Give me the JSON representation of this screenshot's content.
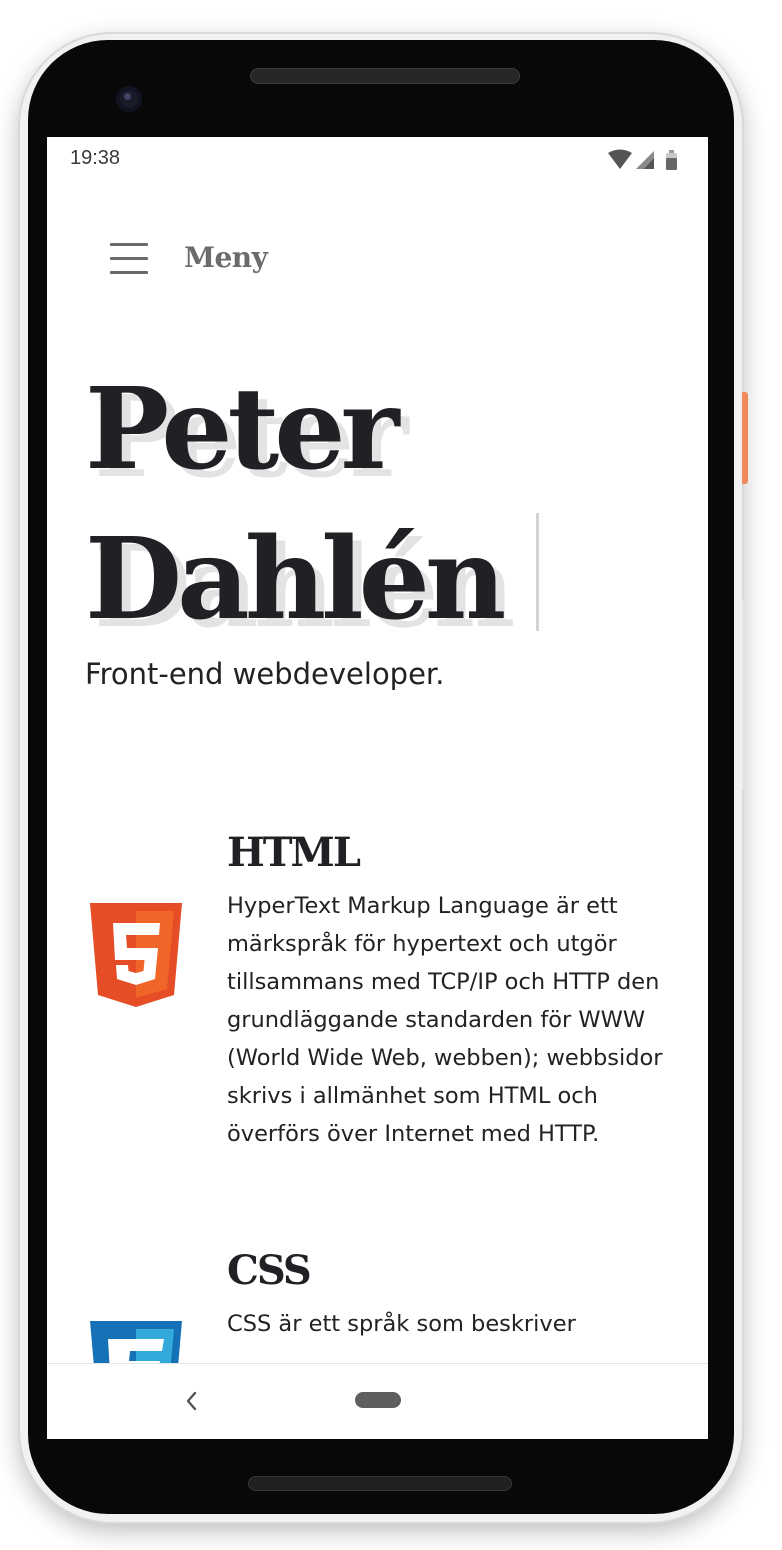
{
  "status_bar": {
    "time": "19:38",
    "icons": [
      "wifi-icon",
      "signal-icon",
      "battery-icon"
    ]
  },
  "menu": {
    "label": "Meny"
  },
  "hero": {
    "name_line1": "Peter",
    "name_line2": "Dahlén",
    "subtitle": "Front-end webdeveloper."
  },
  "skills": [
    {
      "title": "HTML",
      "icon": "html5-logo-icon",
      "description": "HyperText Markup Language är ett märkspråk för hypertext och utgör tillsammans med TCP/IP och HTTP den grundläggande standarden för WWW (World Wide Web, webben); webbsidor skrivs i allmänhet som HTML och överförs över Internet med HTTP."
    },
    {
      "title": "CSS",
      "icon": "css3-logo-icon",
      "description": "CSS är ett språk som beskriver"
    }
  ],
  "colors": {
    "html5_orange": "#e44d26",
    "html5_orange_light": "#f16529",
    "css3_blue": "#1572b6",
    "css3_blue_light": "#33a9dc",
    "phone_power_button": "#f2895b",
    "heading_text": "#1f2125"
  },
  "nav_bar": {
    "icons": [
      "back-chevron-icon",
      "home-pill-icon"
    ]
  }
}
